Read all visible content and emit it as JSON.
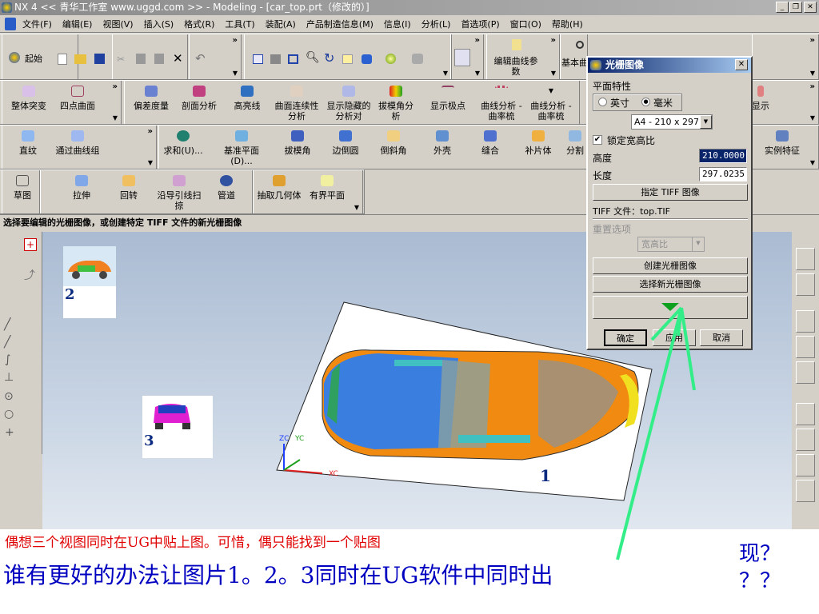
{
  "window": {
    "title": "NX 4 << 青华工作室 www.uggd.com >> - Modeling - [car_top.prt（修改的）]",
    "min": "_",
    "restore": "❐",
    "close": "✕"
  },
  "menu": [
    "文件(F)",
    "编辑(E)",
    "视图(V)",
    "插入(S)",
    "格式(R)",
    "工具(T)",
    "装配(A)",
    "产品制造信息(M)",
    "信息(I)",
    "分析(L)",
    "首选项(P)",
    "窗口(O)",
    "帮助(H)"
  ],
  "toolbar1": {
    "start": "起始",
    "edit_curve_params": "编辑曲线参数",
    "basic": "基本曲"
  },
  "toolbar2": [
    "整体突变",
    "四点曲面",
    "偏差度量",
    "剖面分析",
    "高亮线",
    "曲面连续性分析",
    "显示隐藏的分析对",
    "拔模角分析",
    "显示极点",
    "曲线分析 - 曲率梳",
    "曲线分析 - 曲率梳",
    "显示"
  ],
  "toolbar3": [
    "直纹",
    "通过曲线组",
    "求和(U)...",
    "基准平面(D)...",
    "拔模角",
    "边倒圆",
    "倒斜角",
    "外壳",
    "缝合",
    "补片体",
    "分割",
    "实例特征"
  ],
  "toolbar4": [
    "草图",
    "拉伸",
    "回转",
    "沿导引线扫掠",
    "管道",
    "抽取几何体",
    "有界平面"
  ],
  "status": "选择要编辑的光栅图像，或创建特定 TIFF 文件的新光栅图像",
  "dialog": {
    "title": "光栅图像",
    "plane_props": "平面特性",
    "inch": "英寸",
    "mm": "毫米",
    "unit_selected": "mm",
    "paper": "A4 - 210 x 297",
    "lock_aspect": "锁定宽高比",
    "lock_checked": true,
    "height_label": "高度",
    "height": "210.0000",
    "length_label": "长度",
    "length": "297.0235",
    "specify_tiff": "指定 TIFF 图像",
    "tiff_file": "TIFF 文件：top.TIF",
    "reset_options": "重置选项",
    "aspect": "宽高比",
    "create": "创建光栅图像",
    "select_new": "选择新光栅图像",
    "ok": "确定",
    "apply": "应用",
    "cancel": "取消"
  },
  "viewport": {
    "label1": "1",
    "label2": "2",
    "label3": "3",
    "axis_zc": "ZC",
    "axis_yc": "YC",
    "axis_xc": "XC"
  },
  "annotation": {
    "line1": "偶想三个视图同时在UG中贴上图。可惜，偶只能找到一个贴图",
    "line2": "谁有更好的办法让图片1。2。3同时在UG软件中同时出",
    "tail1": "现？",
    "tail2": "？？",
    "line1_color": "#e00000",
    "line2_color": "#0000c0",
    "arrow_color": "#33ee88"
  }
}
